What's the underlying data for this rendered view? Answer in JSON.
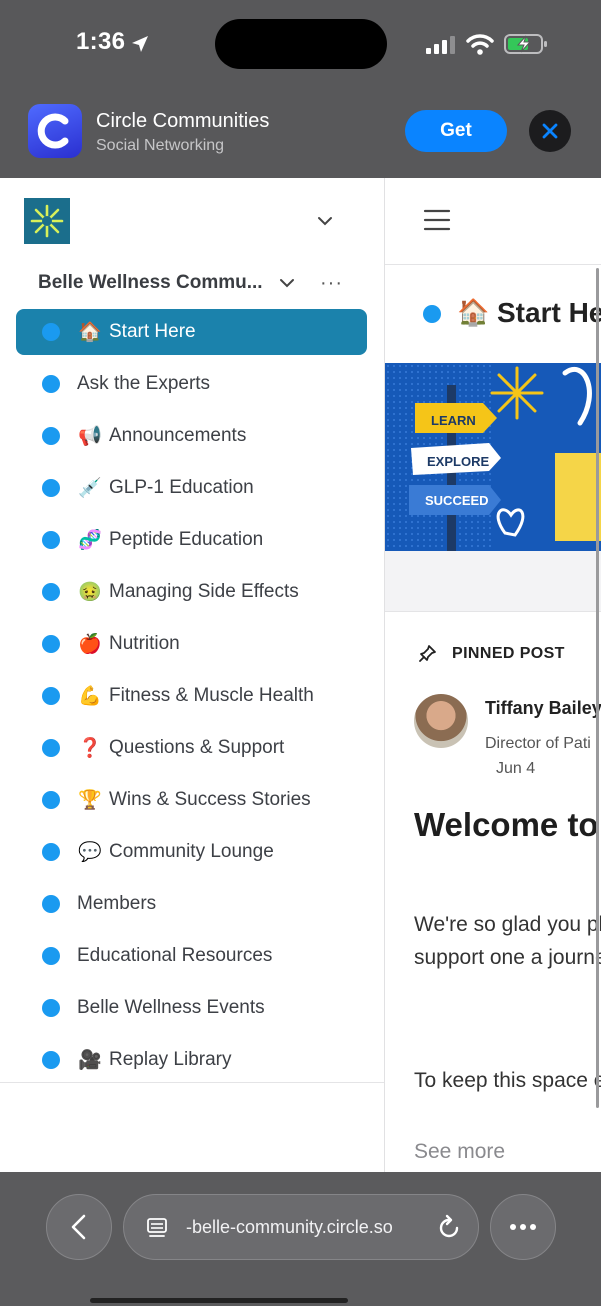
{
  "status": {
    "time": "1:36"
  },
  "app_banner": {
    "app_name": "Circle Communities",
    "category": "Social Networking",
    "get_label": "Get"
  },
  "sidebar": {
    "community_name": "Belle Wellness Commu...",
    "more_label": "···",
    "items": [
      {
        "emoji": "🏠",
        "label": "Start Here",
        "active": true
      },
      {
        "emoji": "",
        "label": "Ask the Experts"
      },
      {
        "emoji": "📢",
        "label": "Announcements"
      },
      {
        "emoji": "💉",
        "label": "GLP-1 Education"
      },
      {
        "emoji": "🧬",
        "label": "Peptide Education"
      },
      {
        "emoji": "🤢",
        "label": "Managing Side Effects"
      },
      {
        "emoji": "🍎",
        "label": "Nutrition"
      },
      {
        "emoji": "💪",
        "label": "Fitness & Muscle Health"
      },
      {
        "emoji": "❓",
        "label": "Questions & Support"
      },
      {
        "emoji": "🏆",
        "label": "Wins & Success Stories"
      },
      {
        "emoji": "💬",
        "label": "Community Lounge"
      },
      {
        "emoji": "",
        "label": "Members"
      },
      {
        "emoji": "",
        "label": "Educational Resources"
      },
      {
        "emoji": "",
        "label": "Belle Wellness Events"
      },
      {
        "emoji": "🎥",
        "label": "Replay Library"
      }
    ]
  },
  "main": {
    "space_emoji": "🏠",
    "space_title": "Start Here",
    "hero_signs": [
      "LEARN",
      "EXPLORE",
      "SUCCEED"
    ],
    "pinned_label": "PINNED POST",
    "author_name": "Tiffany Bailey",
    "author_role": "Director of Pati",
    "post_date": "Jun 4",
    "post_title": "Welcome to Community",
    "post_body_1": "We're so glad you place to learn, sha and support one a journeys.",
    "post_body_2": "To keep this space everyone, please",
    "see_more": "See more"
  },
  "browser": {
    "url": "-belle-community.circle.so"
  },
  "colors": {
    "accent": "#1a9af0",
    "active_item": "#1b82ac",
    "get_button": "#0a84ff",
    "chrome": "#58585a"
  }
}
